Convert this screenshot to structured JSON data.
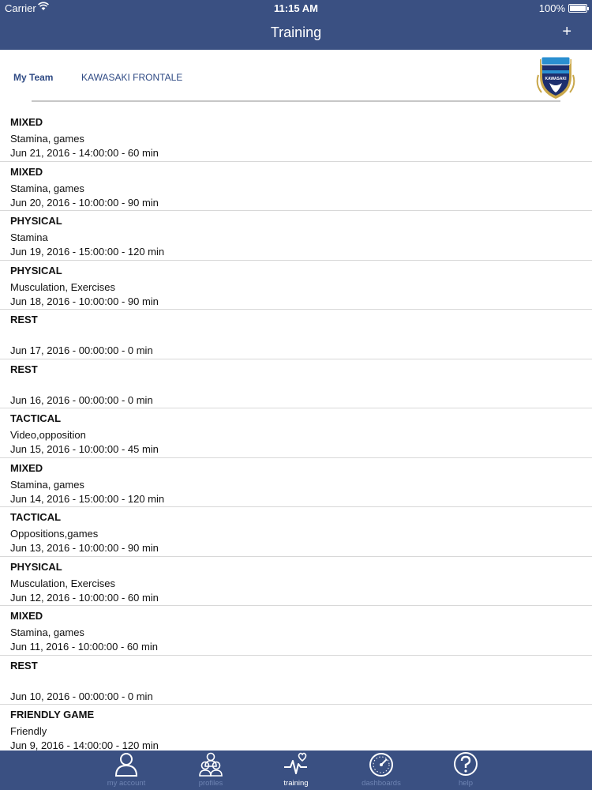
{
  "status": {
    "carrier": "Carrier",
    "time": "11:15 AM",
    "battery": "100%"
  },
  "header": {
    "title": "Training",
    "add_label": "+"
  },
  "team": {
    "my_team_label": "My Team",
    "team_name": "KAWASAKI FRONTALE",
    "crest_text": "KAWASAKI"
  },
  "trainings": [
    {
      "type": "MIXED",
      "desc": "Stamina, games",
      "when": "Jun 21, 2016 - 14:00:00 - 60 min"
    },
    {
      "type": "MIXED",
      "desc": "Stamina, games",
      "when": "Jun 20, 2016 - 10:00:00 - 90 min"
    },
    {
      "type": "PHYSICAL",
      "desc": "Stamina",
      "when": "Jun 19, 2016 - 15:00:00 - 120 min"
    },
    {
      "type": "PHYSICAL",
      "desc": "Musculation, Exercises",
      "when": "Jun 18, 2016 - 10:00:00 - 90 min"
    },
    {
      "type": "REST",
      "desc": "",
      "when": "Jun 17, 2016 - 00:00:00 - 0 min"
    },
    {
      "type": "REST",
      "desc": "",
      "when": "Jun 16, 2016 - 00:00:00 - 0 min"
    },
    {
      "type": "TACTICAL",
      "desc": "Video,opposition",
      "when": "Jun 15, 2016 - 10:00:00 - 45 min"
    },
    {
      "type": "MIXED",
      "desc": "Stamina, games",
      "when": "Jun 14, 2016 - 15:00:00 - 120 min"
    },
    {
      "type": "TACTICAL",
      "desc": "Oppositions,games",
      "when": "Jun 13, 2016 - 10:00:00 - 90 min"
    },
    {
      "type": "PHYSICAL",
      "desc": "Musculation, Exercises",
      "when": "Jun 12, 2016 - 10:00:00 - 60 min"
    },
    {
      "type": "MIXED",
      "desc": "Stamina, games",
      "when": "Jun 11, 2016 - 10:00:00 - 60 min"
    },
    {
      "type": "REST",
      "desc": "",
      "when": "Jun 10, 2016 - 00:00:00 - 0 min"
    },
    {
      "type": "FRIENDLY GAME",
      "desc": "Friendly",
      "when": "Jun 9, 2016 - 14:00:00 - 120 min"
    }
  ],
  "tabbar": {
    "tabs": [
      {
        "label": "my account",
        "icon": "person-icon"
      },
      {
        "label": "profiles",
        "icon": "people-icon"
      },
      {
        "label": "training",
        "icon": "heartbeat-icon"
      },
      {
        "label": "dashboards",
        "icon": "speedometer-icon"
      },
      {
        "label": "help",
        "icon": "question-icon"
      }
    ],
    "active": "training"
  },
  "colors": {
    "bar": "#3a5082",
    "link": "#2f4a84",
    "tab_inactive": "#6e84b3"
  }
}
